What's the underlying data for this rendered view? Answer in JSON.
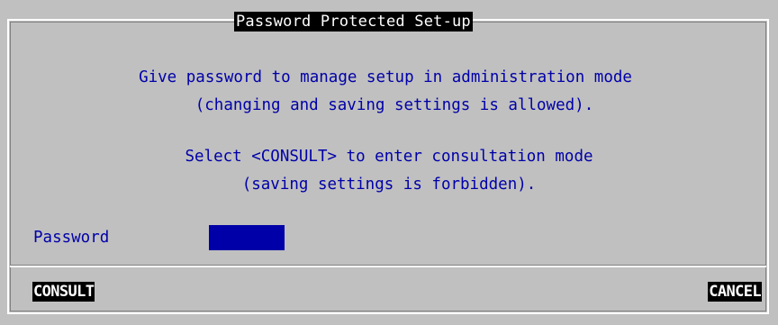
{
  "dialog": {
    "title": "Password Protected Set-up",
    "messages": [
      "Give password to manage setup in administration mode",
      "(changing and saving settings is allowed).",
      "Select <CONSULT> to enter consultation mode",
      "(saving settings is forbidden)."
    ],
    "password": {
      "label": "Password",
      "value": ""
    },
    "buttons": {
      "consult": "CONSULT",
      "cancel": "CANCEL"
    }
  },
  "colors": {
    "background": "#c0c0c0",
    "text": "#0000a8",
    "field": "#0000a8",
    "button_bg": "#000000",
    "button_text": "#ffffff"
  }
}
